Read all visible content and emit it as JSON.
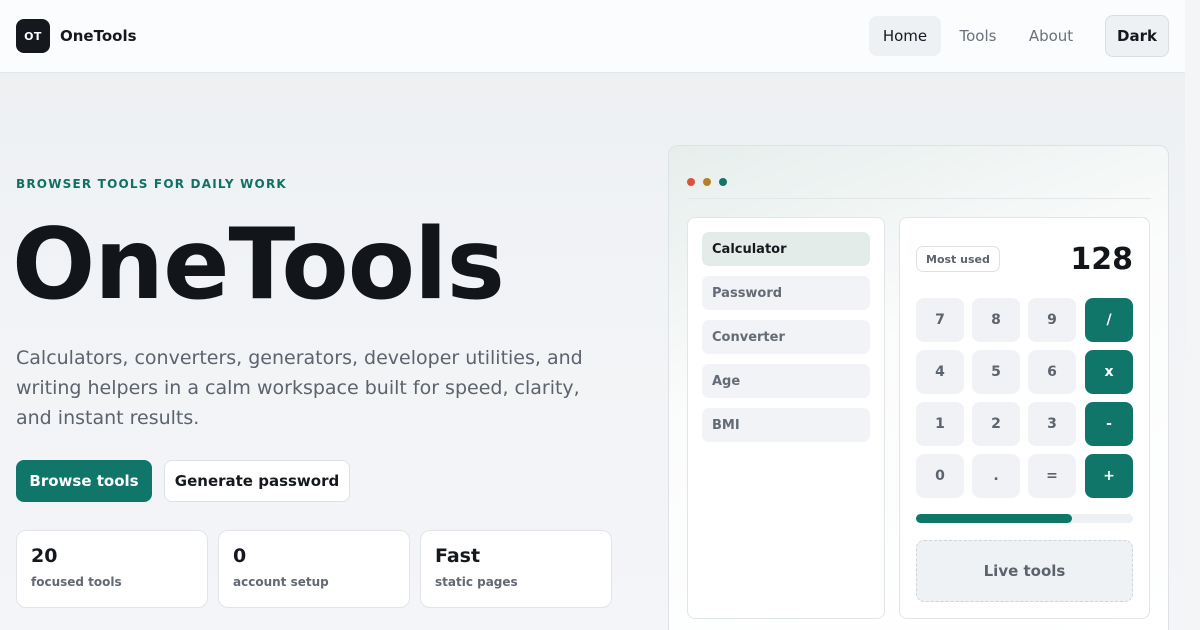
{
  "header": {
    "logo_text": "OT",
    "brand": "OneTools",
    "nav": {
      "home": "Home",
      "tools": "Tools",
      "about": "About"
    },
    "theme_toggle": "Dark"
  },
  "hero": {
    "eyebrow": "BROWSER TOOLS FOR DAILY WORK",
    "title": "OneTools",
    "description": "Calculators, converters, generators, developer utilities, and writing helpers in a calm workspace built for speed, clarity, and instant results.",
    "primary_button": "Browse tools",
    "secondary_button": "Generate password",
    "stats": [
      {
        "value": "20",
        "label": "focused tools"
      },
      {
        "value": "0",
        "label": "account setup"
      },
      {
        "value": "Fast",
        "label": "static pages"
      }
    ]
  },
  "preview": {
    "window_dots": [
      "#d9533d",
      "#b78122",
      "#137465"
    ],
    "sidebar": [
      "Calculator",
      "Password",
      "Converter",
      "Age",
      "BMI"
    ],
    "active_item": "Calculator",
    "badge": "Most used",
    "display": "128",
    "keys": [
      [
        "7",
        "8",
        "9",
        "/"
      ],
      [
        "4",
        "5",
        "6",
        "x"
      ],
      [
        "1",
        "2",
        "3",
        "-"
      ],
      [
        "0",
        ".",
        "=",
        "+"
      ]
    ],
    "progress_fraction": 0.72,
    "live_label": "Live tools"
  },
  "colors": {
    "accent": "#11766a",
    "eyebrow": "#0f7163",
    "ink": "#15191d"
  }
}
